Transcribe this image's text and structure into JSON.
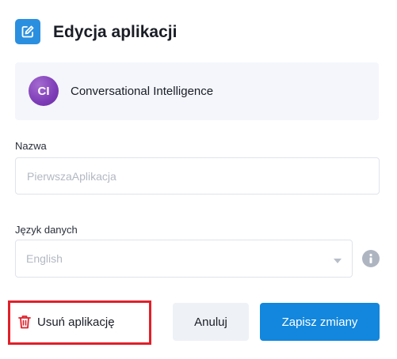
{
  "header": {
    "title": "Edycja aplikacji",
    "icon": "edit-icon",
    "icon_color": "#2b8fe0"
  },
  "app": {
    "initials": "CI",
    "name": "Conversational Intelligence",
    "avatar_color": "#8a45c2"
  },
  "form": {
    "name_label": "Nazwa",
    "name_placeholder": "PierwszaAplikacja",
    "name_value": "",
    "language_label": "Język danych",
    "language_value": "English",
    "language_icon": "chevron-down-icon",
    "info_icon": "info-icon"
  },
  "actions": {
    "delete_label": "Usuń aplikację",
    "delete_icon": "trash-icon",
    "delete_color": "#e0202a",
    "cancel_label": "Anuluj",
    "save_label": "Zapisz zmiany",
    "save_color": "#1287dd"
  }
}
